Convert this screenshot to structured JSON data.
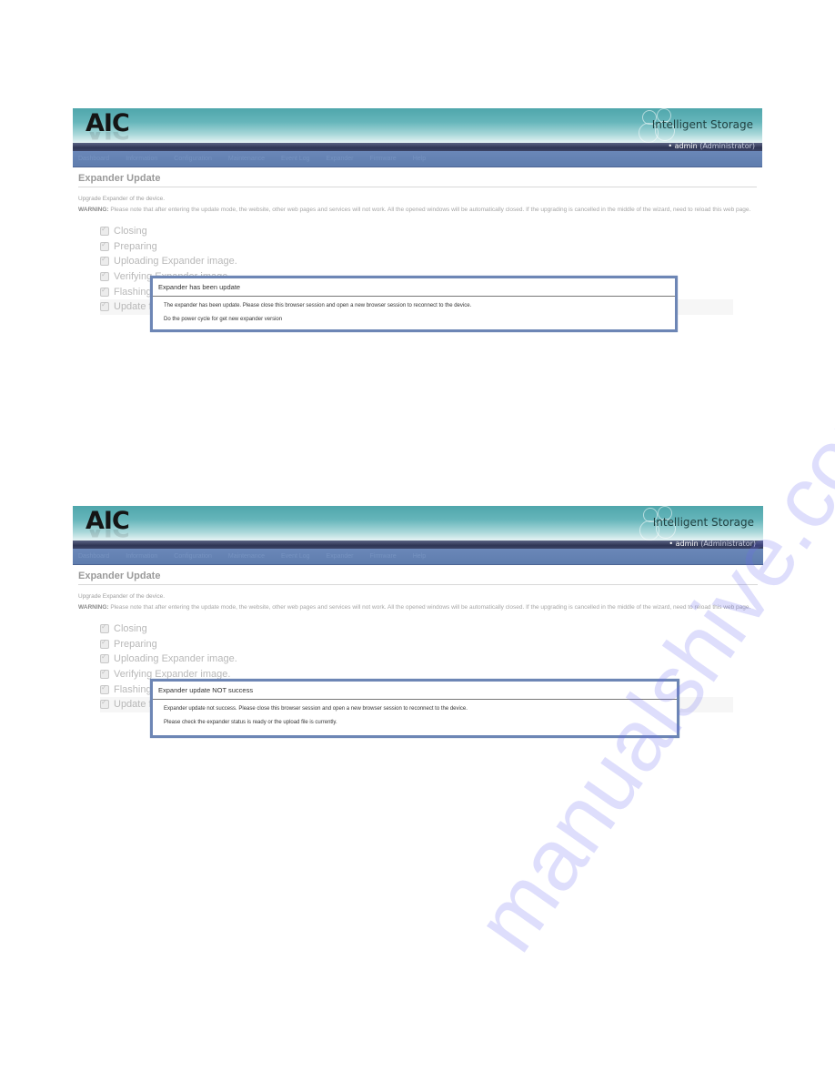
{
  "header": {
    "logo": "AIC",
    "brand": "Intelligent Storage",
    "user": "admin",
    "role": "(Administrator)",
    "user_bullet": "•"
  },
  "nav": {
    "items": [
      "Dashboard",
      "Information",
      "Configuration",
      "Maintenance",
      "Event Log",
      "Expander",
      "Firmware",
      "Help"
    ]
  },
  "page": {
    "title": "Expander Update",
    "subtitle": "Upgrade Expander of the device.",
    "warning_label": "WARNING:",
    "warning_text": "Please note that after entering the update mode, the website, other web pages and services will not work. All the opened windows will be automatically closed. If the upgrading is cancelled in the middle of the wizard, need to reload this web page."
  },
  "screens": [
    {
      "steps": [
        "Closing",
        "Preparing",
        "Uploading Expander image.",
        "Verifying Expander image.",
        "Flashing Expander image. (100%)",
        "Update finished."
      ],
      "dialog": {
        "title": "Expander has been update",
        "line1": "The expander has been update. Please close this browser session and open a new browser session to reconnect to the device.",
        "line2": "Do the power cycle for get new expander version"
      }
    },
    {
      "steps": [
        "Closing",
        "Preparing",
        "Uploading Expander image.",
        "Verifying Expander image.",
        "Flashing Expander image.",
        "Update finished."
      ],
      "dialog": {
        "title": "Expander update NOT success",
        "line1": "Expander update not success. Please close this browser session and open a new browser session to reconnect to the device.",
        "line2": "Please check the expander status is ready or the upload file is currently."
      }
    }
  ],
  "watermark": "manualshive.com",
  "colors": {
    "banner_teal": "#4fa6ab",
    "nav_blue": "#6483b5",
    "userbar_navy": "#2e3554",
    "dialog_border": "#6d86b5"
  }
}
